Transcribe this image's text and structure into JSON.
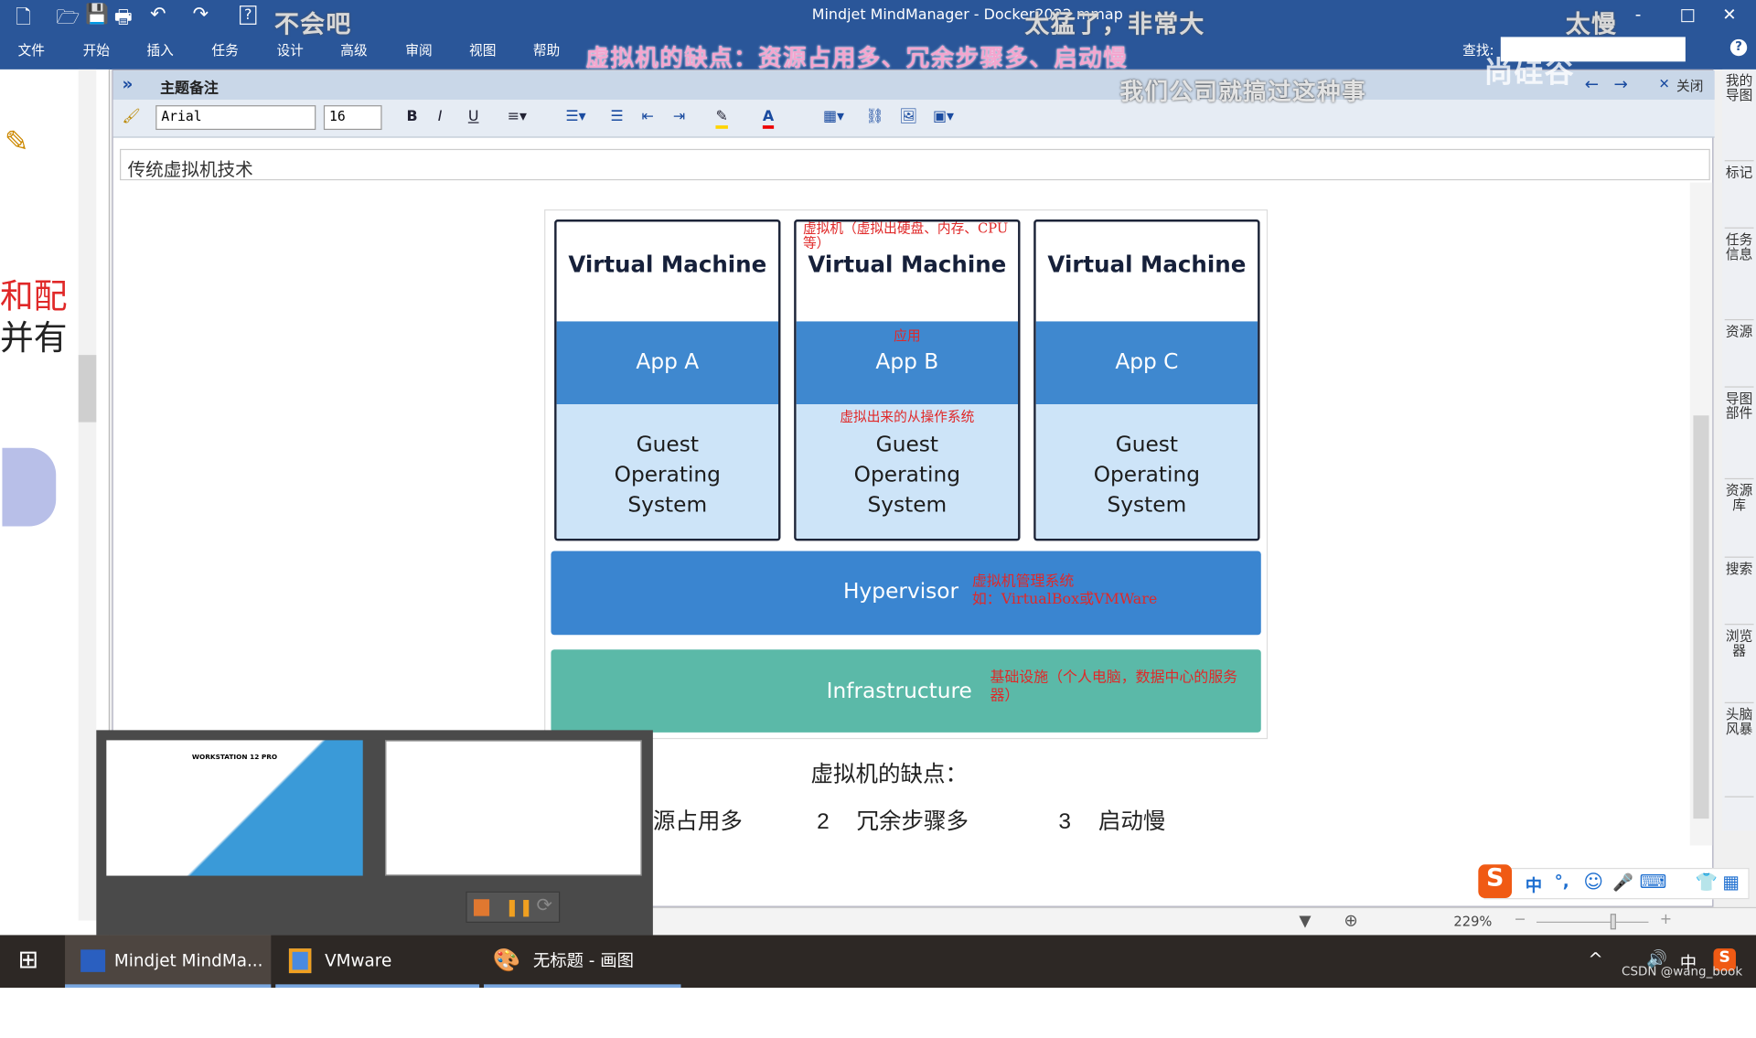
{
  "window": {
    "title": "Mindjet MindManager - Docker2022.mmap",
    "minimize": "-",
    "maximize": "□",
    "close": "✕"
  },
  "qat": [
    "🗋",
    "🗁",
    "💾",
    "🖶",
    "↶",
    "↷",
    "?"
  ],
  "menu": [
    "文件",
    "开始",
    "插入",
    "任务",
    "设计",
    "高级",
    "审阅",
    "视图",
    "帮助"
  ],
  "search": {
    "label": "查找:",
    "value": ""
  },
  "subtitles": {
    "s1": "不会吧",
    "s2": "太猛了，非常大",
    "s3": "虚拟机的缺点：资源占用多、冗余步骤多、启动慢",
    "s4": "我们公司就搞过这种事",
    "s5": "太慢",
    "watermark": "尚硅谷"
  },
  "notes": {
    "header": "主题备注",
    "expand": "»",
    "back": "←",
    "forward": "→",
    "close_x": "✕",
    "close_label": "关闭",
    "font": "Arial",
    "size": "16",
    "bold": "B",
    "italic": "I",
    "underline": "U",
    "subject": "传统虚拟机技术"
  },
  "left_pane": {
    "text1": "和配",
    "text2": "并有"
  },
  "diagram": {
    "vms": [
      {
        "title": "Virtual Machine",
        "app": "App A",
        "os": [
          "Guest",
          "Operating",
          "System"
        ]
      },
      {
        "title": "Virtual Machine",
        "app": "App B",
        "os": [
          "Guest",
          "Operating",
          "System"
        ]
      },
      {
        "title": "Virtual Machine",
        "app": "App C",
        "os": [
          "Guest",
          "Operating",
          "System"
        ]
      }
    ],
    "hypervisor": "Hypervisor",
    "infrastructure": "Infrastructure",
    "annotations": {
      "vm": "虚拟机（虚拟出硬盘、内存、CPU等）",
      "app": "应用",
      "os": "虚拟出来的从操作系统",
      "hyp1": "虚拟机管理系统",
      "hyp2": "如：VirtualBox或VMWare",
      "infra": "基础设施（个人电脑，数据中心的服务器）"
    },
    "colors": {
      "app": "#3f88cf",
      "os": "#cde4f8",
      "hypervisor": "#3a85d0",
      "infrastructure": "#5bb9a8",
      "annotation": "#e02828"
    }
  },
  "cons": {
    "title": "虚拟机的缺点：",
    "item1": "源占用多",
    "n2": "2",
    "item2": "冗余步骤多",
    "n3": "3",
    "item3": "启动慢"
  },
  "sidebar": [
    "我的导图",
    "标记",
    "任务信息",
    "资源",
    "导图部件",
    "资源库",
    "搜索",
    "浏览器",
    "头脑风暴"
  ],
  "status": {
    "zoom": "229%",
    "minus": "−",
    "plus": "+"
  },
  "popup": {
    "thumb1_title": "WORKSTATION 12 PRO"
  },
  "ime": {
    "lang": "中",
    "punct": "°,"
  },
  "taskbar": {
    "items": [
      "Mindjet MindMa...",
      "VMware Worksta...",
      "无标题 - 画图"
    ],
    "tray_lang": "中",
    "watermark": "CSDN @wang_book"
  }
}
